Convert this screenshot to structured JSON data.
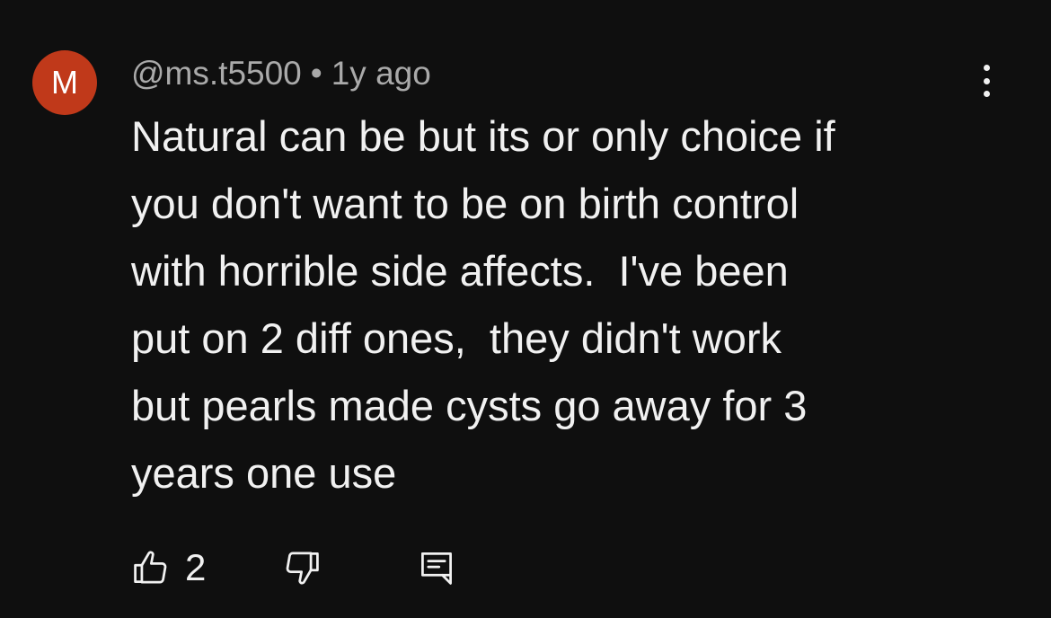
{
  "comment": {
    "avatar_letter": "M",
    "avatar_color": "#c0391a",
    "author": "@ms.t5500",
    "separator": "•",
    "timestamp": "1y ago",
    "text": "Natural can be but its or only choice if\nyou don't want to be on birth control\nwith horrible side affects.  I've been\nput on 2 diff ones,  they didn't work\nbut pearls made cysts go away for 3\nyears one use",
    "like_count": "2",
    "icons": {
      "more": "more-vertical-icon",
      "like": "thumbs-up-icon",
      "dislike": "thumbs-down-icon",
      "reply": "reply-comment-icon"
    }
  },
  "colors": {
    "background": "#0f0f0f",
    "text_primary": "#f1f1f1",
    "text_secondary": "#aaaaaa"
  }
}
